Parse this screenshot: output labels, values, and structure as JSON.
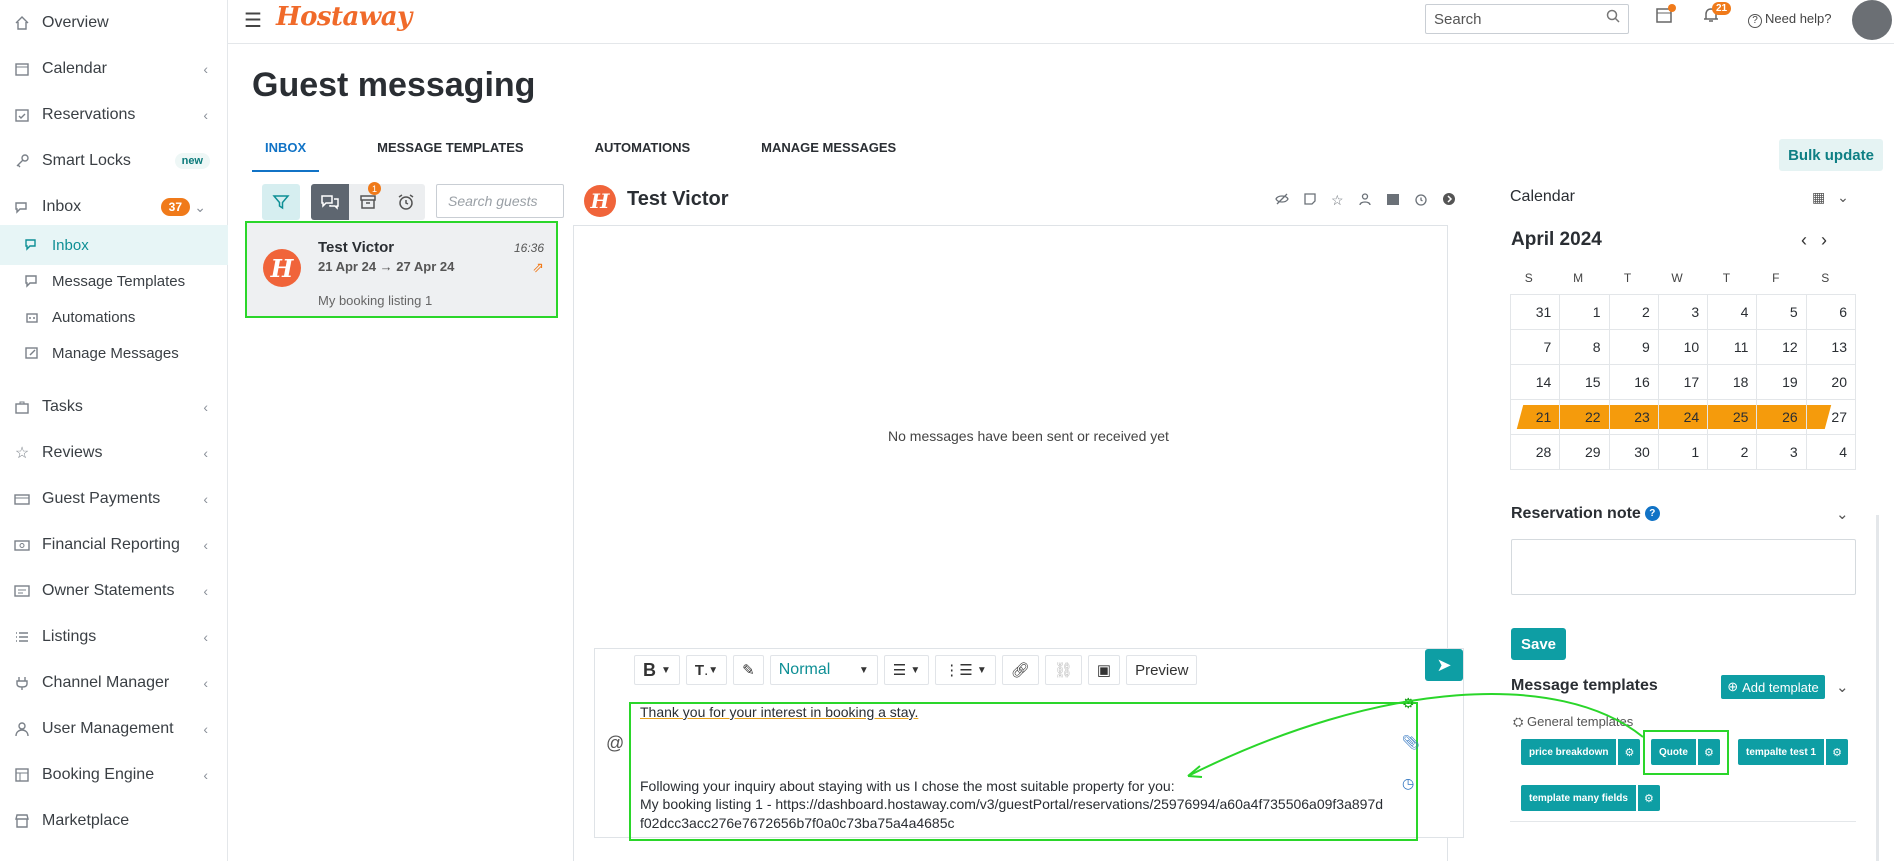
{
  "sidebar": {
    "items": [
      {
        "label": "Overview",
        "icon": "home-icon"
      },
      {
        "label": "Calendar",
        "icon": "calendar-icon"
      },
      {
        "label": "Reservations",
        "icon": "calendar-check-icon"
      },
      {
        "label": "Smart Locks",
        "icon": "key-icon",
        "badge": "new"
      },
      {
        "label": "Inbox",
        "icon": "inbox-icon",
        "count": "37"
      },
      {
        "label": "Tasks",
        "icon": "briefcase-icon"
      },
      {
        "label": "Reviews",
        "icon": "star-icon"
      },
      {
        "label": "Guest Payments",
        "icon": "payment-icon"
      },
      {
        "label": "Financial Reporting",
        "icon": "money-icon"
      },
      {
        "label": "Owner Statements",
        "icon": "statement-icon"
      },
      {
        "label": "Listings",
        "icon": "list-icon"
      },
      {
        "label": "Channel Manager",
        "icon": "plug-icon"
      },
      {
        "label": "User Management",
        "icon": "user-icon"
      },
      {
        "label": "Booking Engine",
        "icon": "booking-icon"
      },
      {
        "label": "Marketplace",
        "icon": "marketplace-icon"
      }
    ],
    "inbox_sub": [
      {
        "label": "Inbox"
      },
      {
        "label": "Message Templates"
      },
      {
        "label": "Automations"
      },
      {
        "label": "Manage Messages"
      }
    ]
  },
  "header": {
    "logo": "Hostaway",
    "search_placeholder": "Search",
    "notifications_count": "21",
    "help_label": "Need help?"
  },
  "page": {
    "title": "Guest messaging",
    "tabs": [
      "INBOX",
      "MESSAGE TEMPLATES",
      "AUTOMATIONS",
      "MANAGE MESSAGES"
    ],
    "bulk_update": "Bulk update"
  },
  "inbox": {
    "archive_badge": "1",
    "search_placeholder": "Search guests",
    "conversation": {
      "name": "Test Victor",
      "dates": "21 Apr 24 → 27 Apr 24",
      "time": "16:36",
      "listing": "My booking listing 1",
      "avatar_letter": "H"
    }
  },
  "thread": {
    "guest_name": "Test Victor",
    "empty_text": "No messages have been sent or received yet"
  },
  "composer": {
    "style_select": "Normal",
    "preview_label": "Preview",
    "line1": "Thank you for your interest in booking a stay.",
    "line2": "Following your inquiry about staying with us I chose the most suitable property for you:",
    "line3": "My booking listing 1 - https://dashboard.hostaway.com/v3/guestPortal/reservations/25976994/a60a4f735506a09f3a897df02dcc3acc276e7672656b7f0a0c73ba75a4a4685c"
  },
  "calendar": {
    "title": "Calendar",
    "month": "April 2024",
    "dow": [
      "S",
      "M",
      "T",
      "W",
      "T",
      "F",
      "S"
    ],
    "weeks": [
      [
        "31",
        "1",
        "2",
        "3",
        "4",
        "5",
        "6"
      ],
      [
        "7",
        "8",
        "9",
        "10",
        "11",
        "12",
        "13"
      ],
      [
        "14",
        "15",
        "16",
        "17",
        "18",
        "19",
        "20"
      ],
      [
        "21",
        "22",
        "23",
        "24",
        "25",
        "26",
        "27"
      ],
      [
        "28",
        "29",
        "30",
        "1",
        "2",
        "3",
        "4"
      ]
    ],
    "booking_color": "#f59b0c"
  },
  "reservation_note": {
    "title": "Reservation note",
    "save_label": "Save"
  },
  "message_templates": {
    "title": "Message templates",
    "add_label": "Add template",
    "group": "General templates",
    "templates": [
      "price breakdown",
      "Quote",
      "tempalte test 1",
      "template many fields"
    ]
  },
  "colors": {
    "accent": "#0e9ea4",
    "brand": "#f06a2a",
    "highlight": "#2ad62a"
  }
}
